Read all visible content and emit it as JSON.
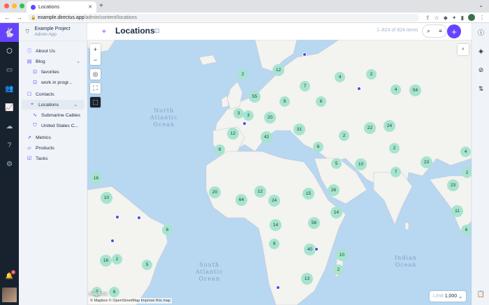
{
  "browser": {
    "tab_title": "Locations",
    "url_host": "example.directus.app",
    "url_path": "/admin/content/locations",
    "traffic_lights": [
      "#ff5f57",
      "#febc2e",
      "#28c840"
    ]
  },
  "project": {
    "name": "Example Project",
    "subtitle": "Admin App"
  },
  "nav": {
    "items": [
      {
        "label": "About Us",
        "icon": "info-icon",
        "level": 0
      },
      {
        "label": "Blog",
        "icon": "book-icon",
        "level": 0,
        "expandable": true
      },
      {
        "label": "favorites",
        "icon": "bookmark-icon",
        "level": 1
      },
      {
        "label": "work in progr...",
        "icon": "bookmark-icon",
        "level": 1
      },
      {
        "label": "Contacts",
        "icon": "person-icon",
        "level": 0
      },
      {
        "label": "Locations",
        "icon": "pin-icon",
        "level": 0,
        "expandable": true,
        "active": true
      },
      {
        "label": "Submarine Cables",
        "icon": "cable-icon",
        "level": 1
      },
      {
        "label": "United States C...",
        "icon": "map-icon",
        "level": 1
      },
      {
        "label": "Metrics",
        "icon": "chart-icon",
        "level": 0
      },
      {
        "label": "Products",
        "icon": "product-icon",
        "level": 0
      },
      {
        "label": "Tasks",
        "icon": "checkbox-icon",
        "level": 0
      }
    ]
  },
  "header": {
    "title": "Locations",
    "count": "1–824 of 824 items"
  },
  "map": {
    "labels": {
      "north_atlantic": "North\nAtlantic\nOcean",
      "south_atlantic": "South\nAtlantic\nOcean",
      "indian": "Indian\nOcean"
    },
    "attribution": "© Mapbox © OpenStreetMap  Improve this map",
    "mapbox_logo": "mapbox",
    "limit_label": "Limit",
    "limit_value": "1,000",
    "clusters": [
      "12",
      "2",
      "4",
      "2",
      "3",
      "4",
      "54",
      "55",
      "9",
      "7",
      "6",
      "3",
      "20",
      "31",
      "2",
      "22",
      "24",
      "12",
      "42",
      "6",
      "8",
      "2",
      "4",
      "5",
      "10",
      "7",
      "23",
      "16",
      "2",
      "10",
      "20",
      "12",
      "64",
      "24",
      "15",
      "26",
      "23",
      "14",
      "11",
      "6",
      "14",
      "56",
      "6",
      "2",
      "5",
      "16",
      "9",
      "40",
      "10",
      "2",
      "6",
      "7",
      "13"
    ]
  },
  "colors": {
    "accent": "#6644ff",
    "rail": "#18222f",
    "cluster": "#a7e4cf",
    "point": "#4b4ce0"
  }
}
